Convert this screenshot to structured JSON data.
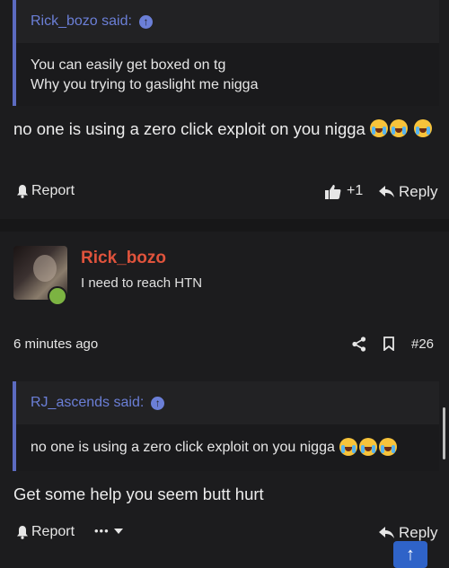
{
  "post1": {
    "quote": {
      "author": "Rick_bozo said:",
      "lines": [
        "You can easily get boxed on tg",
        "Why you trying to gaslight me nigga"
      ]
    },
    "message": "no one is using a zero click exploit on you nigga",
    "actions": {
      "report": "Report",
      "reactions": "+1",
      "reply": "Reply"
    }
  },
  "post2": {
    "user": {
      "name": "Rick_bozo",
      "title": "I need to reach HTN",
      "name_color": "#e0533c"
    },
    "meta": {
      "time": "6 minutes ago",
      "post_number": "#26"
    },
    "quote": {
      "author": "RJ_ascends said:",
      "text": "no one is using a zero click exploit on you nigga"
    },
    "message": "Get some help you seem butt hurt",
    "actions": {
      "report": "Report",
      "more": "•••",
      "reply": "Reply"
    }
  },
  "colors": {
    "accent": "#5c6bc0",
    "quote_link": "#6b7fd7",
    "online": "#7cb342",
    "scroll_top": "#2f63c8"
  },
  "icons": [
    "arrow-up-icon",
    "bell-icon",
    "thumbs-up-icon",
    "reply-icon",
    "share-icon",
    "bookmark-icon",
    "chevron-down-icon",
    "crying-laughing-emoji"
  ]
}
